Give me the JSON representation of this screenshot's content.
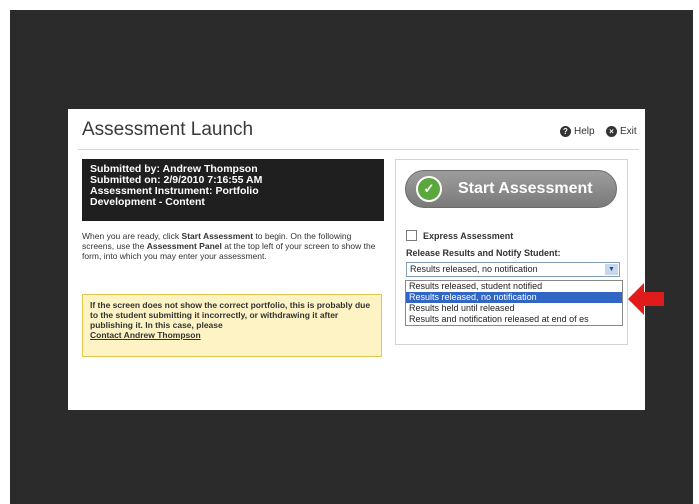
{
  "dialog": {
    "title": "Assessment Launch",
    "help_label": "Help",
    "exit_label": "Exit"
  },
  "submission": {
    "line1": "Submitted by: Andrew Thompson",
    "line2": "Submitted on: 2/9/2010 7:16:55 AM",
    "line3": "Assessment Instrument: Portfolio",
    "line4": "Development - Content"
  },
  "intro": {
    "part1": "When you are ready, click ",
    "bold1": "Start Assessment",
    "part2": " to begin. On the following screens, use the ",
    "bold2": "Assessment Panel",
    "part3": " at the top left of your screen to show the form, into which you may enter your assessment."
  },
  "warning": {
    "text": "If the screen does not show the correct portfolio, this is probably due to the student submitting it incorrectly, or withdrawing it after publishing it. In this case, please",
    "link": "Contact Andrew Thompson"
  },
  "panel": {
    "start_label": "Start Assessment",
    "express_label": "Express Assessment",
    "release_label": "Release Results and Notify Student:",
    "selected_value": "Results released, no notification"
  },
  "dropdown_options": [
    "Results released, student notified",
    "Results released, no notification",
    "Results held until released",
    "Results and notification released at end of es"
  ],
  "colors": {
    "backdrop": "#2b2b2b",
    "start_button": "#8a8a8a",
    "check_green": "#5aa83c",
    "warning_bg": "#fdf3c4",
    "selected_option": "#3166c5",
    "arrow_red": "#e01b1b"
  }
}
